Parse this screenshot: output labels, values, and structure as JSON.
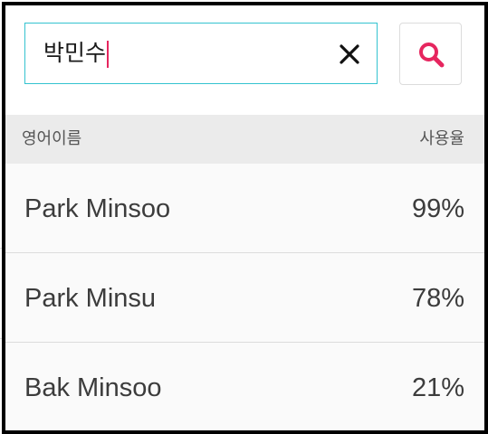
{
  "search": {
    "query": "박민수",
    "clear_icon": "close-icon",
    "search_icon": "search-icon",
    "accent_color": "#e6265f",
    "focus_border_color": "#34c3d0"
  },
  "table": {
    "columns": [
      "영어이름",
      "사용율"
    ],
    "rows": [
      {
        "name": "Park Minsoo",
        "rate": "99%"
      },
      {
        "name": "Park Minsu",
        "rate": "78%"
      },
      {
        "name": "Bak Minsoo",
        "rate": "21%"
      }
    ]
  }
}
